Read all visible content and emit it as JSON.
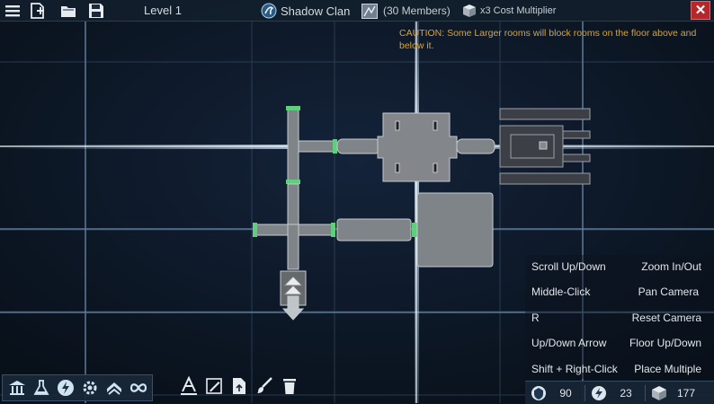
{
  "topbar": {
    "level_label": "Level 1",
    "clan_name": "Shadow Clan",
    "members": "(30 Members)",
    "cost_multiplier": "x3 Cost Multiplier",
    "close_label": "✕"
  },
  "caution": "CAUTION: Some Larger rooms will block rooms on the floor above and below it.",
  "controls": [
    {
      "input": "Scroll Up/Down",
      "action": "Zoom In/Out"
    },
    {
      "input": "Middle-Click",
      "action": "Pan Camera"
    },
    {
      "input": "R",
      "action": "Reset Camera"
    },
    {
      "input": "Up/Down Arrow",
      "action": "Floor Up/Down"
    },
    {
      "input": "Shift + Right-Click",
      "action": "Place Multiple"
    }
  ],
  "resources": [
    {
      "icon": "shield-icon",
      "value": "90"
    },
    {
      "icon": "bolt-icon",
      "value": "23"
    },
    {
      "icon": "crate-icon",
      "value": "177"
    }
  ],
  "colors": {
    "accent": "#d8a33a",
    "close": "#b7262a",
    "room_fill": "#7f8489"
  }
}
